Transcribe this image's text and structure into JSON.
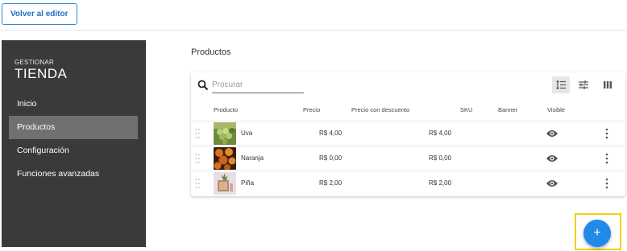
{
  "header": {
    "back_label": "Volver al editor"
  },
  "sidebar": {
    "kicker": "GESTIONAR",
    "title": "TIENDA",
    "items": [
      {
        "label": "Inicio",
        "active": false
      },
      {
        "label": "Productos",
        "active": true
      },
      {
        "label": "Configuración",
        "active": false
      },
      {
        "label": "Funciones avanzadas",
        "active": false
      }
    ]
  },
  "main": {
    "section_title": "Productos",
    "search": {
      "placeholder": "Procurar",
      "value": ""
    },
    "toolbar": [
      "list-view-icon",
      "filter-icon",
      "columns-icon"
    ],
    "columns": {
      "product": "Producto",
      "price": "Precio",
      "discount_price": "Precio con descuento",
      "sku": "SKU",
      "banner": "Banner",
      "visible": "Visible"
    },
    "products": [
      {
        "name": "Uva",
        "price": "R$ 4,00",
        "discount_price": "R$ 4,00",
        "thumb": "grapes"
      },
      {
        "name": "Naranja",
        "price": "R$ 0,00",
        "discount_price": "R$ 0,00",
        "thumb": "oranges"
      },
      {
        "name": "Piña",
        "price": "R$ 2,00",
        "discount_price": "R$ 2,00",
        "thumb": "pineapple"
      }
    ],
    "fab_label": "+"
  },
  "colors": {
    "accent": "#1f8ae8",
    "sidebar_bg": "#3a3a3a",
    "highlight": "#f5cd16"
  }
}
